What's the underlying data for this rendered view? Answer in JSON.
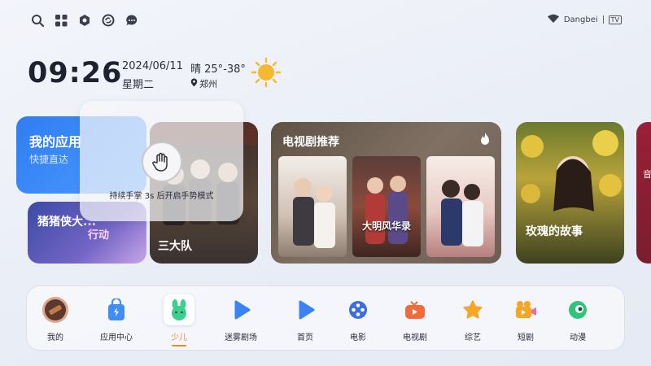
{
  "topbar": {
    "icons": [
      "search-icon",
      "apps-grid-icon",
      "settings-icon",
      "refresh-icon",
      "message-icon"
    ],
    "brand": "Dangbei",
    "brand_sub": "TV"
  },
  "status": {
    "time": "09:26",
    "date": "2024/06/11",
    "weekday": "星期二",
    "weather": "晴 25°-38°",
    "city": "郑州"
  },
  "cards": {
    "my_apps_title": "我的应用",
    "my_apps_sub": "快捷直达",
    "zzx_title": "猪猪侠大",
    "zzx_tail": "行动",
    "sdd_title": "三大队",
    "tv_rec_title": "电视剧推荐",
    "poster2_title": "大明风华录",
    "rose_title": "玫瑰的故事",
    "edge_label": "音"
  },
  "overlay": {
    "message": "持续手掌 3s 后开启手势模式"
  },
  "nav": {
    "items": [
      {
        "label": "我的"
      },
      {
        "label": "应用中心"
      },
      {
        "label": "少儿"
      },
      {
        "label": "迷雾剧场"
      },
      {
        "label": "首页"
      },
      {
        "label": "电影"
      },
      {
        "label": "电视剧"
      },
      {
        "label": "综艺"
      },
      {
        "label": "短剧"
      },
      {
        "label": "动漫"
      }
    ],
    "active_index": 2
  },
  "colors": {
    "accent_blue": "#2f7df2",
    "active_orange": "#e0902a",
    "sun": "#f5b82e"
  }
}
